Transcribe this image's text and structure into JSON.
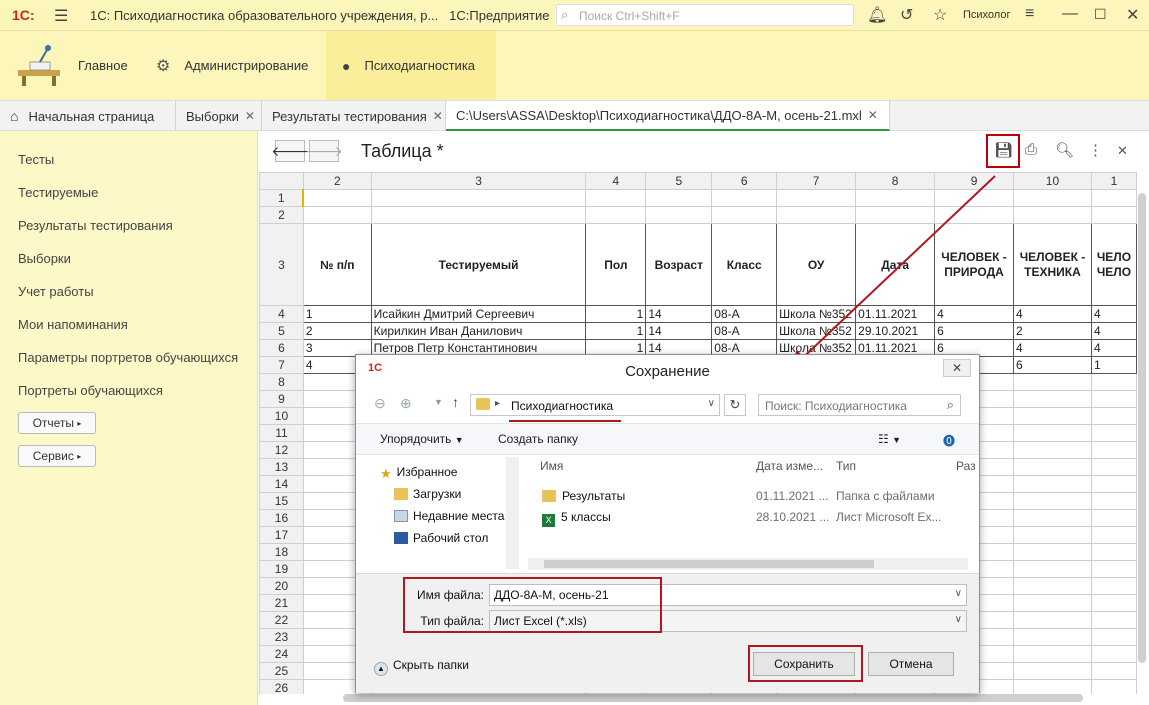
{
  "titlebar": {
    "logo": "1С:",
    "title": "1С: Психодиагностика образовательного учреждения, р...",
    "platform": "1С:Предприятие",
    "search_placeholder": "Поиск Ctrl+Shift+F",
    "user": "Психолог"
  },
  "sections": [
    {
      "label": "Главное",
      "icon": "home-desk-icon"
    },
    {
      "label": "Администрирование",
      "icon": "gear-icon"
    },
    {
      "label": "Психодиагностика",
      "icon": "person-icon"
    }
  ],
  "tabs": [
    {
      "label": "Начальная страница",
      "icon": "home-icon"
    },
    {
      "label": "Выборки",
      "closable": true
    },
    {
      "label": "Результаты тестирования",
      "closable": true
    },
    {
      "label": "C:\\Users\\ASSA\\Desktop\\Психодиагностика\\ДДО-8А-М, осень-21.mxl",
      "closable": true,
      "active": true
    }
  ],
  "sidebar": {
    "items": [
      "Тесты",
      "Тестируемые",
      "Результаты тестирования",
      "Выборки",
      "Учет работы",
      "Мои напоминания",
      "Параметры портретов обучающихся",
      "Портреты обучающихся"
    ],
    "buttons": [
      "Отчеты",
      "Сервис"
    ]
  },
  "form": {
    "title": "Таблица *"
  },
  "sheet": {
    "col_headers": [
      "2",
      "3",
      "4",
      "5",
      "6",
      "7",
      "8",
      "9",
      "10",
      "1"
    ],
    "header_row": [
      "№ п/п",
      "Тестируемый",
      "Пол",
      "Возраст",
      "Класс",
      "ОУ",
      "Дата",
      "ЧЕЛОВЕК - ПРИРОДА",
      "ЧЕЛОВЕК - ТЕХНИКА",
      "ЧЕЛО ЧЕЛО"
    ],
    "rows": [
      [
        "1",
        "Исайкин Дмитрий Сергеевич",
        "1",
        "14",
        "08-А",
        "Школа №352",
        "01.11.2021",
        "4",
        "4",
        "4"
      ],
      [
        "2",
        "Кирилкин Иван Данилович",
        "1",
        "14",
        "08-А",
        "Школа №352",
        "29.10.2021",
        "6",
        "2",
        "4"
      ],
      [
        "3",
        "Петров Петр Константинович",
        "1",
        "14",
        "08-А",
        "Школа №352",
        "01.11.2021",
        "6",
        "4",
        "4"
      ],
      [
        "4",
        "",
        "",
        "",
        "",
        "",
        "",
        "",
        "6",
        "1"
      ]
    ],
    "row_numbers": [
      "1",
      "2",
      "3",
      "4",
      "5",
      "6",
      "7",
      "8",
      "9",
      "10",
      "11",
      "12",
      "13",
      "14",
      "15",
      "16",
      "17",
      "18",
      "19",
      "20",
      "21",
      "22",
      "23",
      "24",
      "25",
      "26"
    ]
  },
  "dialog": {
    "title": "Сохранение",
    "address": "Психодиагностика",
    "search_placeholder": "Поиск: Психодиагностика",
    "organize": "Упорядочить",
    "new_folder": "Создать папку",
    "tree": {
      "favorites": "Избранное",
      "items": [
        "Загрузки",
        "Недавние места",
        "Рабочий стол"
      ]
    },
    "columns": [
      "Имя",
      "Дата изме...",
      "Тип",
      "Раз"
    ],
    "files": [
      {
        "name": "Результаты",
        "date": "01.11.2021 ...",
        "type": "Папка с файлами",
        "icon": "folder-icon"
      },
      {
        "name": "5 классы",
        "date": "28.10.2021 ...",
        "type": "Лист Microsoft Ex...",
        "icon": "excel-icon"
      }
    ],
    "filename_label": "Имя файла:",
    "filename_value": "ДДО-8А-М, осень-21",
    "filetype_label": "Тип файла:",
    "filetype_value": "Лист Excel (*.xls)",
    "hide_folders": "Скрыть папки",
    "save_button": "Сохранить",
    "cancel_button": "Отмена"
  },
  "colors": {
    "accent_yellow": "#fdf6ba",
    "annotation_red": "#b0171f",
    "active_tab_underline": "#2c9c3c"
  }
}
